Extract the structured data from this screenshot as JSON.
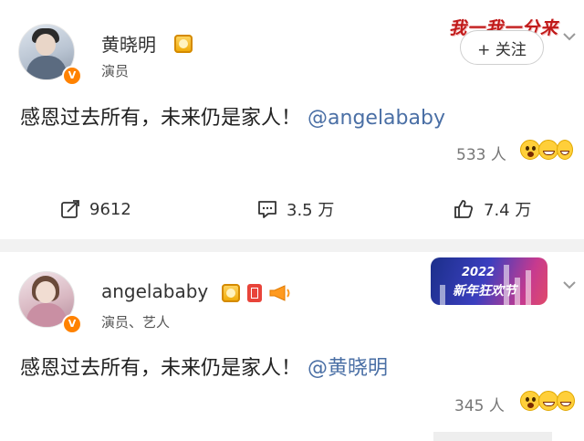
{
  "posts": [
    {
      "user_name": "黄晓明",
      "verified_label": "演员",
      "follow_label": "+ 关关注",
      "follow_button": "+ 关注",
      "banner_text": "我一我一分来",
      "content_text": "感恩过去所有，未来仍是家人！",
      "mention": "@angelababy",
      "reaction_count": "533 人",
      "actions": {
        "repost_count": "9612",
        "comment_count": "3.5 万",
        "like_count": "7.4 万"
      }
    },
    {
      "user_name": "angelababy",
      "verified_label": "演员、艺人",
      "badge_year": "2022",
      "badge_text": "新年狂欢节",
      "content_text": "感恩过去所有，未来仍是家人！",
      "mention": "@黄晓明",
      "reaction_count": "345 人"
    }
  ],
  "icons": {
    "verified": "V",
    "follow_plus": "+"
  },
  "colors": {
    "accent": "#ff8200",
    "link": "#4a6fa5",
    "banner_red": "#c11a1a"
  }
}
